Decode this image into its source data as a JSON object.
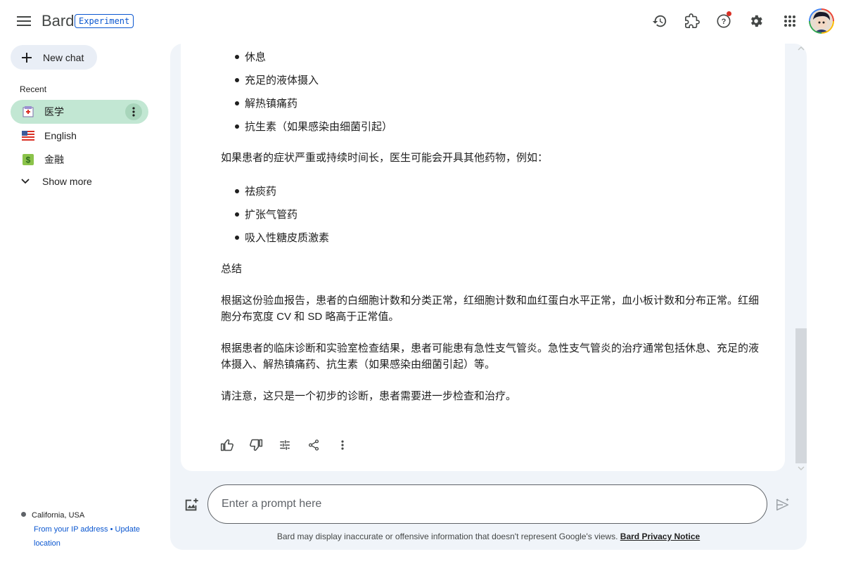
{
  "header": {
    "brand": "Bard",
    "badge": "Experiment",
    "icons": [
      "menu-icon",
      "history-icon",
      "extensions-icon",
      "help-icon",
      "settings-icon",
      "apps-grid-icon"
    ]
  },
  "sidebar": {
    "new_chat_label": "New chat",
    "recent_label": "Recent",
    "items": [
      {
        "label": "医学",
        "icon": "hospital-icon",
        "active": true
      },
      {
        "label": "English",
        "icon": "us-flag-icon",
        "active": false
      },
      {
        "label": "金融",
        "icon": "money-icon",
        "active": false
      }
    ],
    "show_more_label": "Show more",
    "location": {
      "place": "California, USA",
      "from_ip": "From your IP address",
      "separator": "•",
      "update_location": "Update location"
    }
  },
  "response": {
    "bullets_top": [
      "休息",
      "充足的液体摄入",
      "解热镇痛药",
      "抗生素（如果感染由细菌引起）"
    ],
    "para1": "如果患者的症状严重或持续时间长，医生可能会开具其他药物，例如：",
    "bullets_mid": [
      "祛痰药",
      "扩张气管药",
      "吸入性糖皮质激素"
    ],
    "summary_heading": "总结",
    "para2": "根据这份验血报告，患者的白细胞计数和分类正常，红细胞计数和血红蛋白水平正常，血小板计数和分布正常。红细胞分布宽度 CV 和 SD 略高于正常值。",
    "para3": "根据患者的临床诊断和实验室检查结果，患者可能患有急性支气管炎。急性支气管炎的治疗通常包括休息、充足的液体摄入、解热镇痛药、抗生素（如果感染由细菌引起）等。",
    "para4": "请注意，这只是一个初步的诊断，患者需要进一步检查和治疗。"
  },
  "actions": [
    "thumb-up-icon",
    "thumb-down-icon",
    "tune-icon",
    "share-icon",
    "more-vert-icon"
  ],
  "input": {
    "placeholder": "Enter a prompt here",
    "value": ""
  },
  "footer": {
    "disclaimer": "Bard may display inaccurate or offensive information that doesn't represent Google's views.",
    "privacy_link": "Bard Privacy Notice"
  },
  "colors": {
    "accent": "#0b57d0",
    "active_chat_bg": "#c2e7d3",
    "panel_bg": "#f0f4f9",
    "new_chat_bg": "#e9eef6"
  }
}
